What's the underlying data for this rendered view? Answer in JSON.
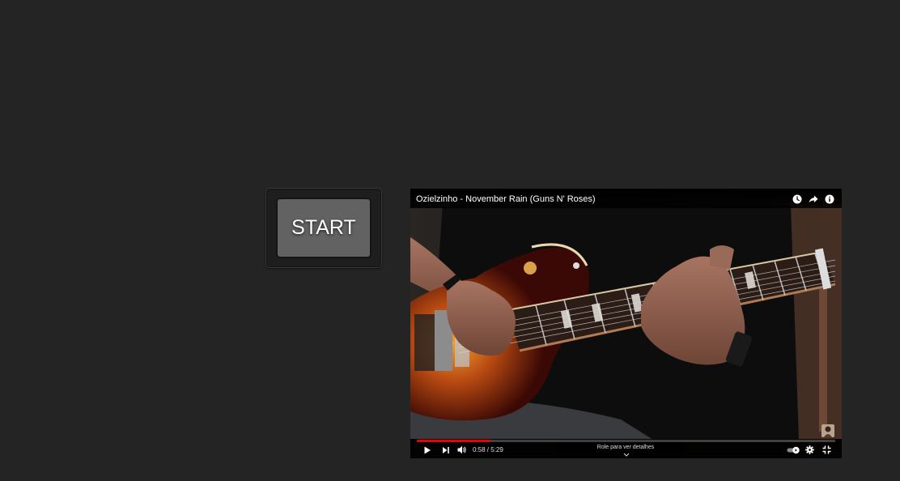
{
  "start_button": {
    "label": "START"
  },
  "video": {
    "title": "Ozielzinho - November Rain (Guns N' Roses)",
    "current_time": "0:58",
    "duration": "5:29",
    "time_display": "0:58 / 5:29",
    "progress_fraction": 0.176,
    "scroll_hint": "Role para ver detalhes",
    "top_icons": [
      "watch-later-icon",
      "share-icon",
      "info-icon"
    ],
    "controls": [
      "play-icon",
      "next-icon",
      "volume-icon",
      "autoplay-toggle",
      "settings-icon",
      "exit-fullscreen-icon"
    ]
  },
  "colors": {
    "background": "#242424",
    "button_face": "#626262",
    "progress": "#ee0000"
  }
}
